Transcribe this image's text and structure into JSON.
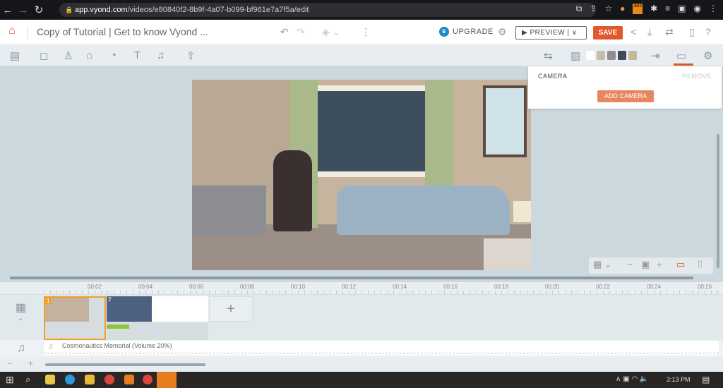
{
  "browser": {
    "url_host": "app.vyond.com",
    "url_path": "/videos/e80840f2-8b9f-4a07-b099-bf961e7a7f5a/edit",
    "badge": "302"
  },
  "header": {
    "title": "Copy of Tutorial | Get to know Vyond ...",
    "upgrade": "UPGRADE",
    "preview": "▶ PREVIEW  |  ∨",
    "save": "SAVE"
  },
  "toolbar": {
    "swatches": [
      "#ffffff",
      "#c2c0a4",
      "#8e8e8e",
      "#3e4a55",
      "#c9b79a"
    ]
  },
  "camera_panel": {
    "label": "CAMERA",
    "remove": "REMOVE",
    "add": "ADD CAMERA"
  },
  "timeline": {
    "ticks": [
      "00:02",
      "00:04",
      "00:06",
      "00:08",
      "00:10",
      "00:12",
      "00:14",
      "00:16",
      "00:18",
      "00:20",
      "00:22",
      "00:24",
      "00:26"
    ],
    "scenes": [
      {
        "number": "1"
      },
      {
        "number": "2"
      }
    ],
    "add_scene": "+",
    "audio_track": "Cosmonautics Memorial (Volume 20%)"
  },
  "taskbar": {
    "time": "3:13 PM"
  }
}
